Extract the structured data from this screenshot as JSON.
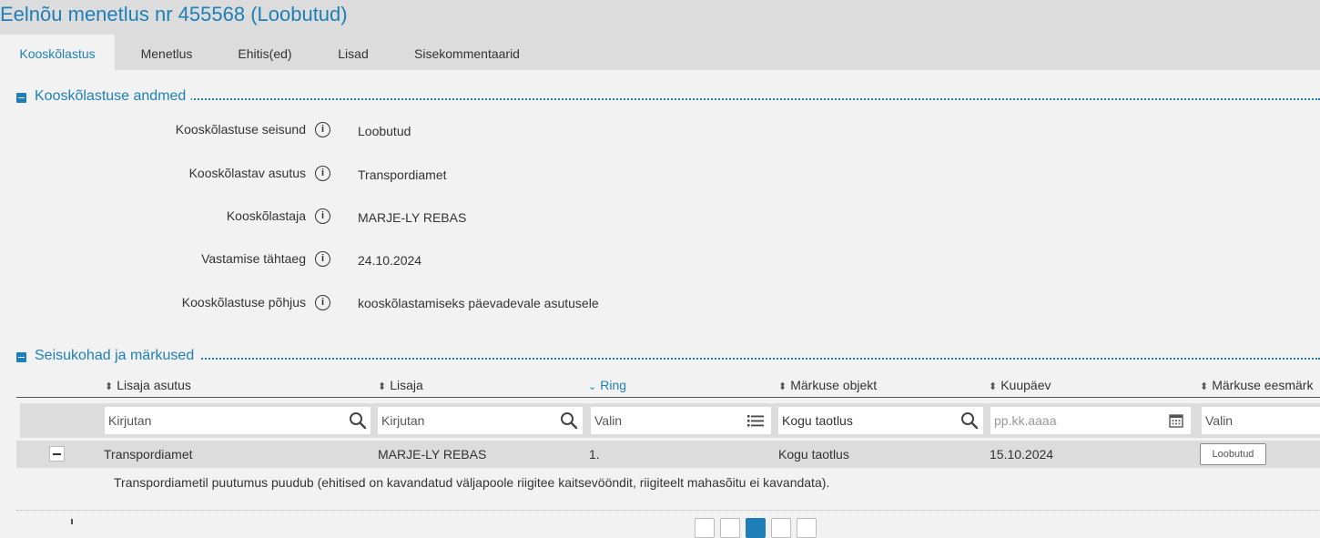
{
  "page": {
    "title": "Eelnõu menetlus nr 455568 (Loobutud)"
  },
  "tabs": [
    {
      "label": "Kooskõlastus",
      "active": true
    },
    {
      "label": "Menetlus"
    },
    {
      "label": "Ehitis(ed)"
    },
    {
      "label": "Lisad"
    },
    {
      "label": "Sisekommentaarid"
    }
  ],
  "details": {
    "section_title": "Kooskõlastuse andmed",
    "fields": [
      {
        "label": "Kooskõlastuse seisund",
        "value": "Loobutud"
      },
      {
        "label": "Kooskõlastav asutus",
        "value": "Transpordiamet"
      },
      {
        "label": "Kooskõlastaja",
        "value": "MARJE-LY REBAS"
      },
      {
        "label": "Vastamise tähtaeg",
        "value": "24.10.2024"
      },
      {
        "label": "Kooskõlastuse põhjus",
        "value": "kooskõlastamiseks päevadevale asutusele"
      }
    ]
  },
  "remarks": {
    "section_title": "Seisukohad ja märkused",
    "columns": [
      "Lisaja asutus",
      "Lisaja",
      "Ring",
      "Märkuse objekt",
      "Kuupäev",
      "Märkuse eesmärk"
    ],
    "sorted_column": "Ring",
    "filters": {
      "lisaja_asutus": "Kirjutan",
      "lisaja": "Kirjutan",
      "ring": "Valin",
      "markuse_objekt": "Kogu taotlus",
      "kuupaev": "pp.kk.aaaa",
      "eesmark": "Valin"
    },
    "rows": [
      {
        "lisaja_asutus": "Transpordiamet",
        "lisaja": "MARJE-LY REBAS",
        "ring": "1.",
        "markuse_objekt": "Kogu taotlus",
        "kuupaev": "15.10.2024",
        "eesmark": "Loobutud",
        "comment": "Transpordiametil puutumus puudub (ehitised on kavandatud väljapoole riigitee kaitsevööndit, riigiteelt mahasõitu ei kavandata)."
      }
    ]
  },
  "icons": {
    "info": "info-icon",
    "search": "search-icon",
    "list": "list-icon",
    "calendar": "calendar-icon",
    "sort": "sort-icon",
    "collapse": "minus-icon"
  },
  "colors": {
    "accent": "#1e7fb8",
    "header_bg": "#dcdcdc",
    "page_bg": "#f2f2f2"
  }
}
